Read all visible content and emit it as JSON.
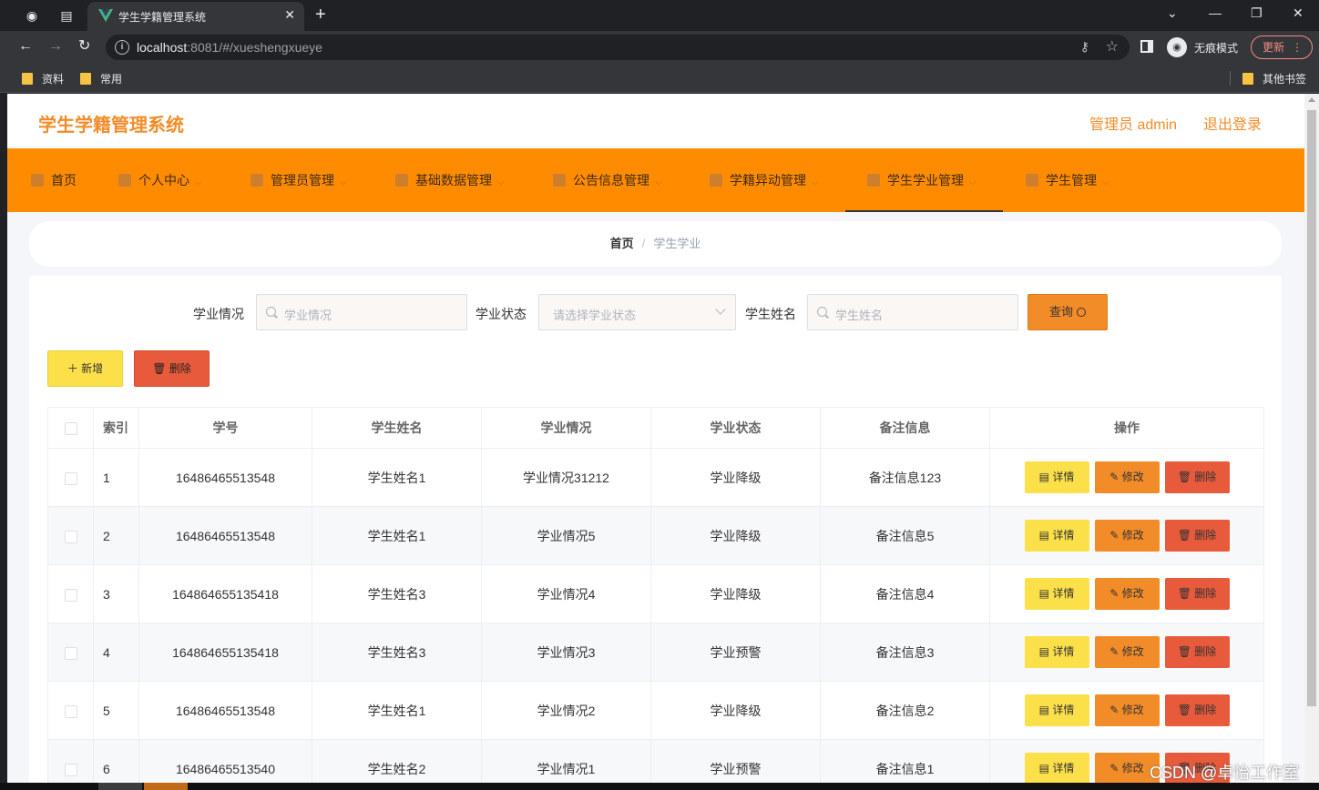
{
  "browser": {
    "tab_title": "学生学籍管理系统",
    "url_host": "localhost",
    "url_rest": ":8081/#/xueshengxueye",
    "incognito_label": "无痕模式",
    "update_label": "更新",
    "bookmarks": [
      "资料",
      "常用"
    ],
    "other_bookmarks": "其他书签"
  },
  "header": {
    "site_title": "学生学籍管理系统",
    "admin_label": "管理员 admin",
    "logout_label": "退出登录"
  },
  "nav": {
    "items": [
      {
        "label": "首页",
        "icon": "home-icon"
      },
      {
        "label": "个人中心",
        "icon": "user-icon"
      },
      {
        "label": "管理员管理",
        "icon": "clipboard-icon"
      },
      {
        "label": "基础数据管理",
        "icon": "grid-icon"
      },
      {
        "label": "公告信息管理",
        "icon": "message-icon"
      },
      {
        "label": "学籍异动管理",
        "icon": "compass-icon"
      },
      {
        "label": "学生学业管理",
        "icon": "monitor-icon"
      },
      {
        "label": "学生管理",
        "icon": "monitor-icon"
      }
    ],
    "active_index": 6
  },
  "breadcrumb": {
    "home": "首页",
    "separator": "/",
    "current": "学生学业"
  },
  "search": {
    "label_situation": "学业情况",
    "placeholder_situation": "学业情况",
    "label_status": "学业状态",
    "placeholder_status": "请选择学业状态",
    "label_name": "学生姓名",
    "placeholder_name": "学生姓名",
    "query_label": "查询"
  },
  "actions": {
    "add_label": "新增",
    "delete_label": "删除"
  },
  "table": {
    "headers": [
      "索引",
      "学号",
      "学生姓名",
      "学业情况",
      "学业状态",
      "备注信息",
      "操作"
    ],
    "rows": [
      {
        "index": "1",
        "student_no": "16486465513548",
        "name": "学生姓名1",
        "situation": "学业情况31212",
        "status": "学业降级",
        "remark": "备注信息123"
      },
      {
        "index": "2",
        "student_no": "16486465513548",
        "name": "学生姓名1",
        "situation": "学业情况5",
        "status": "学业降级",
        "remark": "备注信息5"
      },
      {
        "index": "3",
        "student_no": "164864655135418",
        "name": "学生姓名3",
        "situation": "学业情况4",
        "status": "学业降级",
        "remark": "备注信息4"
      },
      {
        "index": "4",
        "student_no": "164864655135418",
        "name": "学生姓名3",
        "situation": "学业情况3",
        "status": "学业预警",
        "remark": "备注信息3"
      },
      {
        "index": "5",
        "student_no": "16486465513548",
        "name": "学生姓名1",
        "situation": "学业情况2",
        "status": "学业降级",
        "remark": "备注信息2"
      },
      {
        "index": "6",
        "student_no": "16486465513540",
        "name": "学生姓名2",
        "situation": "学业情况1",
        "status": "学业预警",
        "remark": "备注信息1"
      }
    ],
    "op_labels": {
      "detail": "详情",
      "edit": "修改",
      "delete": "删除"
    }
  },
  "watermark": "CSDN @卓怡工作室",
  "colors": {
    "accent": "#ff8c00",
    "title": "#f28c28",
    "detail_button": "#fbe04a",
    "edit_button": "#f28c28",
    "delete_button": "#e85a3c"
  }
}
